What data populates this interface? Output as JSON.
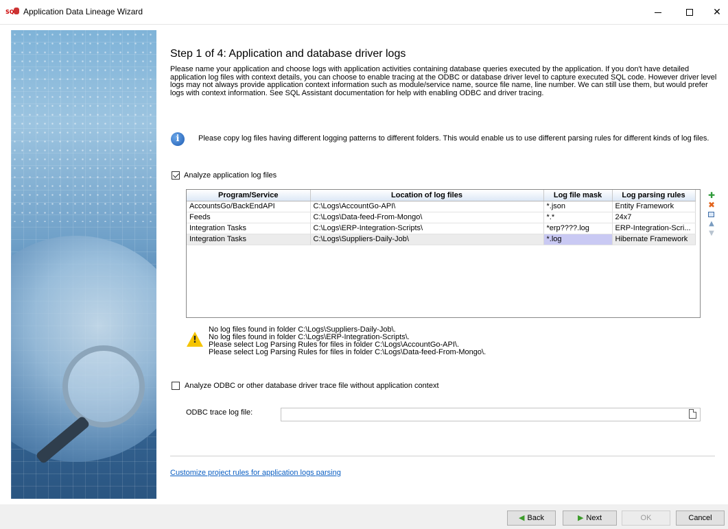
{
  "window": {
    "title": "Application Data Lineage Wizard",
    "icon_text": "SQL",
    "minimize": "—",
    "maximize": "",
    "close": "✕"
  },
  "page": {
    "step_title": "Step 1 of 4:  Application and database driver logs",
    "intro": "Please name your application and choose logs with application activities containing database queries executed by the application. If you don't have detailed application log files with context details, you can choose to enable tracing at the ODBC or database driver level to capture executed SQL code. However driver level logs may not always provide application context information such as module/service name, source file name, line number. We can still use them, but would prefer logs with context information. See SQL Assistant documentation for help with enabling ODBC and driver tracing.",
    "info_icon": "i",
    "info_text": "Please copy log files having different logging patterns to different folders. This would enable us to use different parsing rules for different kinds of log files."
  },
  "app_logs": {
    "checkbox_label": "Analyze application log files",
    "checked": true,
    "columns": [
      "Program/Service",
      "Location of log files",
      "Log file mask",
      "Log parsing rules"
    ],
    "rows": [
      [
        "AccountsGo/BackEndAPI",
        "C:\\Logs\\AccountGo-API\\",
        "*.json",
        "Entity Framework"
      ],
      [
        "Feeds",
        "C:\\Logs\\Data-feed-From-Mongo\\",
        "*.*",
        "24x7"
      ],
      [
        "Integration Tasks",
        "C:\\Logs\\ERP-Integration-Scripts\\",
        "*erp????.log",
        "ERP-Integration-Scri..."
      ],
      [
        "Integration Tasks",
        "C:\\Logs\\Suppliers-Daily-Job\\",
        "*.log",
        "Hibernate Framework"
      ]
    ],
    "selected_row": 3,
    "tools": {
      "add": "✚",
      "delete": "✖",
      "up": "▲",
      "down": "▼"
    }
  },
  "warnings": {
    "icon": "!",
    "lines": [
      "No log files found in folder C:\\Logs\\Suppliers-Daily-Job\\.",
      "No log files found in folder C:\\Logs\\ERP-Integration-Scripts\\.",
      "Please select Log Parsing Rules for files in folder C:\\Logs\\AccountGo-API\\.",
      "Please select Log Parsing Rules for files in folder C:\\Logs\\Data-feed-From-Mongo\\."
    ]
  },
  "odbc": {
    "checkbox_label": "Analyze ODBC or other database driver trace file without application context",
    "checked": false,
    "field_label": "ODBC trace log file:",
    "field_value": ""
  },
  "footer": {
    "custom_link": "Customize project rules for application logs parsing",
    "back": "Back",
    "next": "Next",
    "ok": "OK",
    "cancel": "Cancel",
    "back_arrow": "◀",
    "next_arrow": "▶"
  }
}
